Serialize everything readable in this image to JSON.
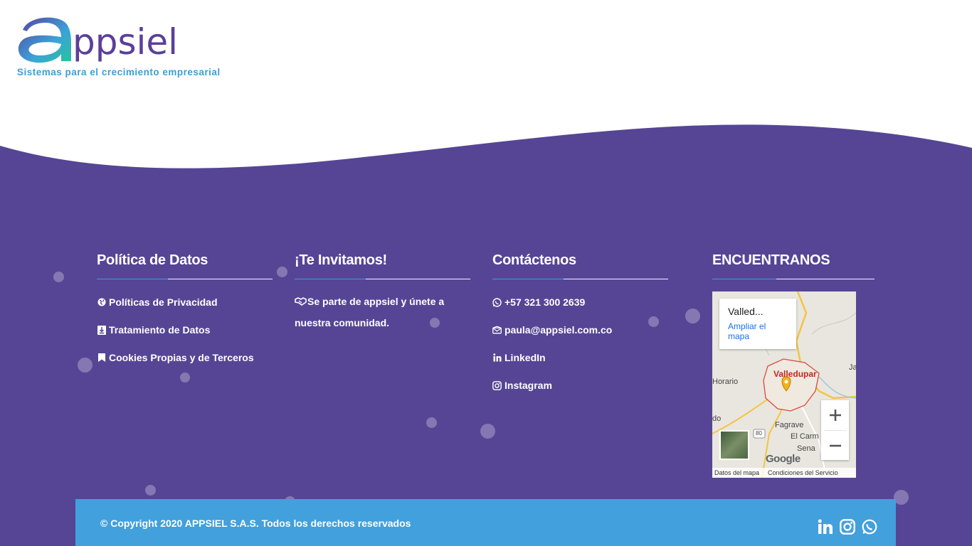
{
  "header": {
    "logo_text": "appsiel",
    "tagline": "Sistemas para el crecimiento empresarial"
  },
  "colors": {
    "purple": "#564595",
    "blue": "#42a0dc",
    "logo_teal": "#2bb5a4"
  },
  "columns": {
    "privacy": {
      "title": "Política de Datos",
      "items": [
        {
          "icon": "globe-icon",
          "label": "Políticas de Privacidad"
        },
        {
          "icon": "download-icon",
          "label": "Tratamiento de Datos"
        },
        {
          "icon": "bookmark-icon",
          "label": "Cookies Propias y de Terceros"
        }
      ]
    },
    "invite": {
      "title": "¡Te Invitamos!",
      "icon": "handshake-icon",
      "text": "Se parte de appsiel y únete a nuestra comunidad."
    },
    "contact": {
      "title": "Contáctenos",
      "items": [
        {
          "icon": "whatsapp-icon",
          "label": "+57 321 300 2639"
        },
        {
          "icon": "envelope-icon",
          "label": "paula@appsiel.com.co"
        },
        {
          "icon": "linkedin-icon",
          "label": "LinkedIn"
        },
        {
          "icon": "instagram-icon",
          "label": "Instagram"
        }
      ]
    },
    "find": {
      "title": "ENCUENTRANOS"
    }
  },
  "map": {
    "place": "Valled...",
    "enlarge": "Ampliar el mapa",
    "city": "Valledupar",
    "labels": [
      "Horario",
      "Fagrave",
      "El Carm",
      "Sena",
      "do",
      "Ja",
      "80"
    ],
    "zoom_in": "+",
    "zoom_out": "−",
    "logo": "Google",
    "data_link": "Datos del mapa",
    "terms_link": "Condiciones del Servicio"
  },
  "footer": {
    "copyright": "© Copyright 2020 APPSIEL S.A.S. Todos los derechos reservados",
    "social": [
      "linkedin-icon",
      "instagram-icon",
      "whatsapp-icon"
    ]
  }
}
